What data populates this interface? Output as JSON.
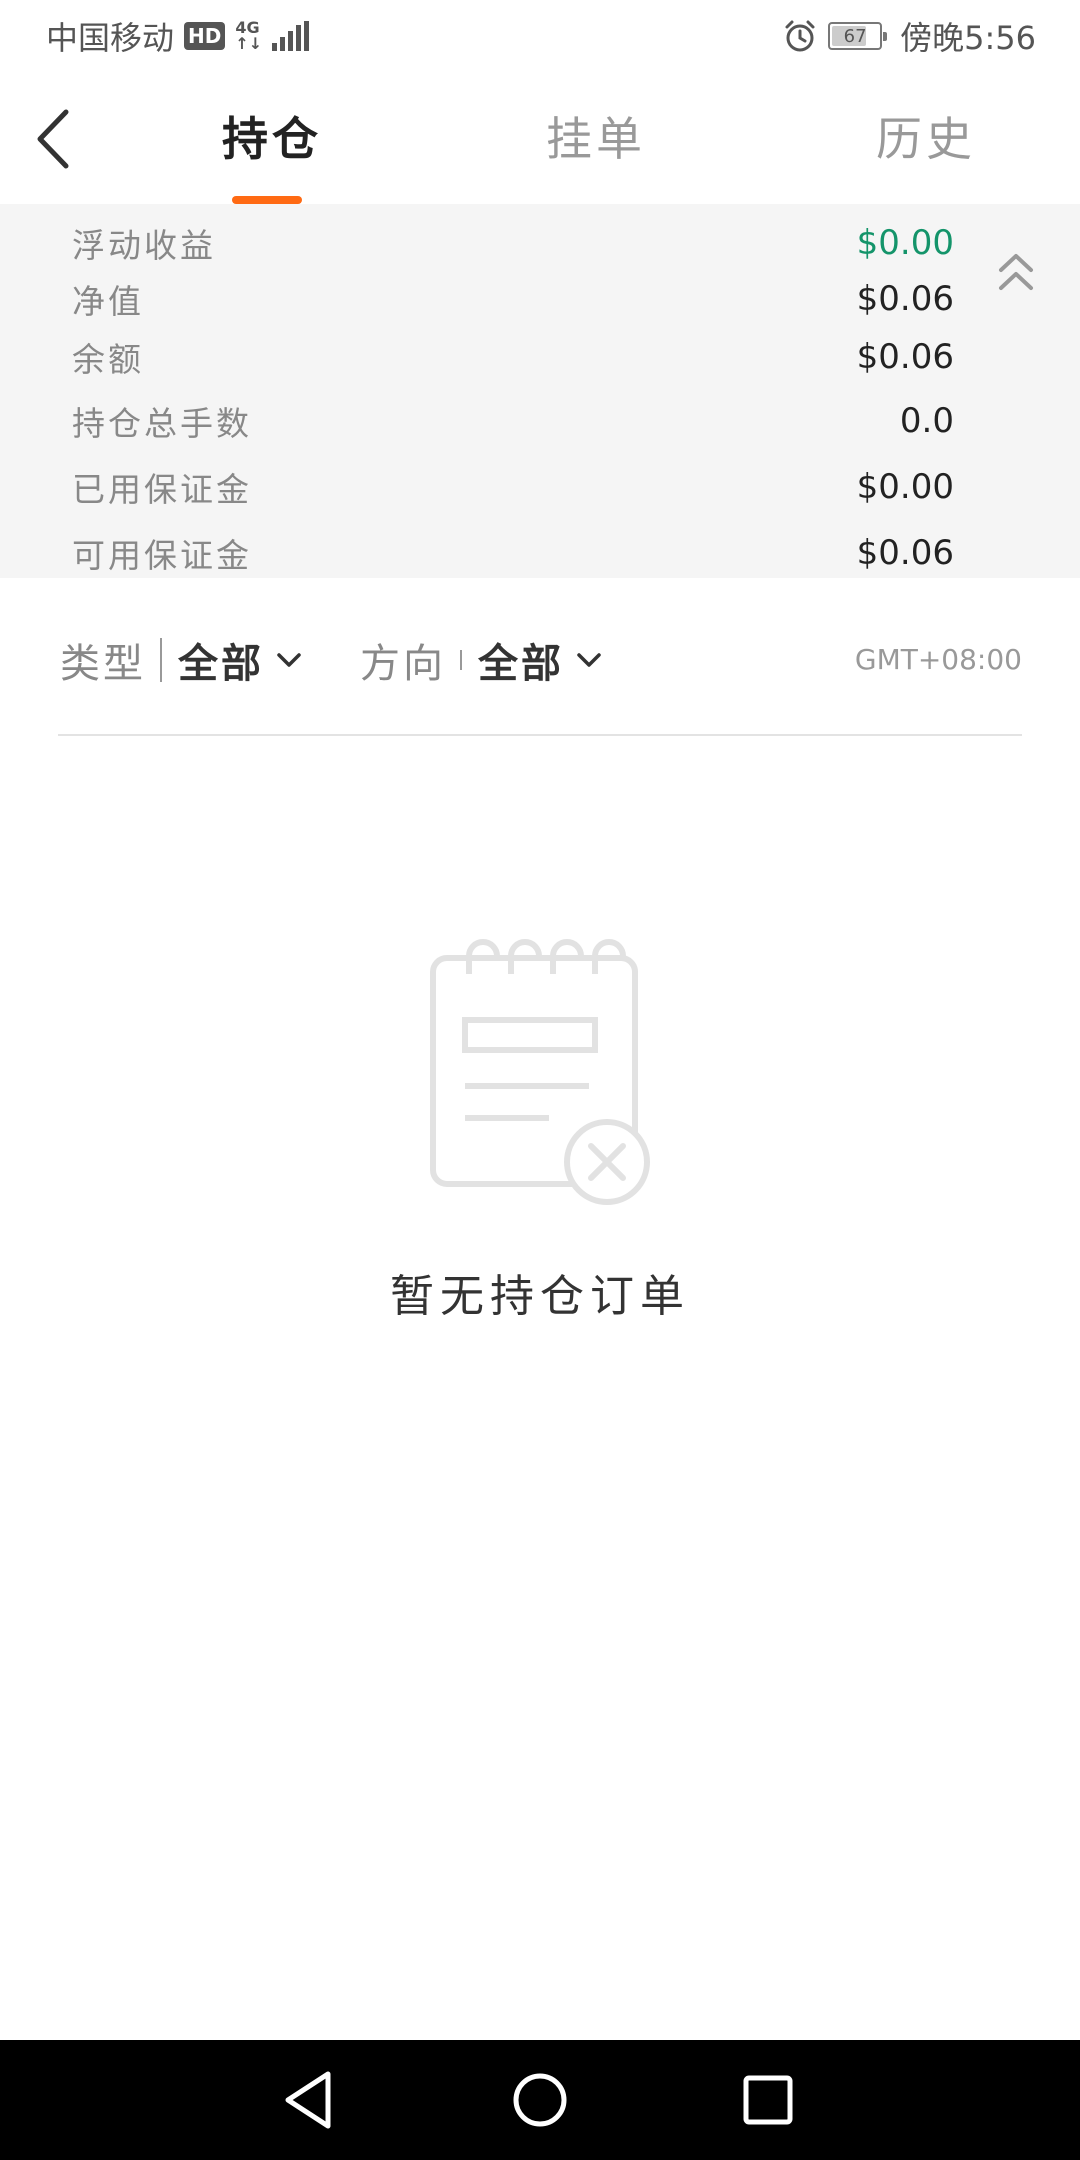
{
  "status_bar": {
    "carrier": "中国移动",
    "hd_badge": "HD",
    "network_top": "4G",
    "network_bottom": "↑↓",
    "battery_level": "67",
    "time": "傍晚5:56"
  },
  "header": {
    "tabs": [
      {
        "label": "持仓",
        "active": true
      },
      {
        "label": "挂单",
        "active": false
      },
      {
        "label": "历史",
        "active": false
      }
    ],
    "accent_color": "#ff6a13"
  },
  "summary": {
    "rows": [
      {
        "label": "浮动收益",
        "value": "$0.00"
      },
      {
        "label": "净值",
        "value": "$0.06"
      },
      {
        "label": "余额",
        "value": "$0.06"
      },
      {
        "label": "持仓总手数",
        "value": "0.0"
      },
      {
        "label": "已用保证金",
        "value": "$0.00"
      },
      {
        "label": "可用保证金",
        "value": "$0.06"
      }
    ],
    "positive_color": "#14946a"
  },
  "filters": {
    "type": {
      "label": "类型",
      "value": "全部"
    },
    "direction": {
      "label": "方向",
      "value": "全部"
    },
    "timezone": "GMT+08:00"
  },
  "empty_state": {
    "message": "暂无持仓订单"
  }
}
